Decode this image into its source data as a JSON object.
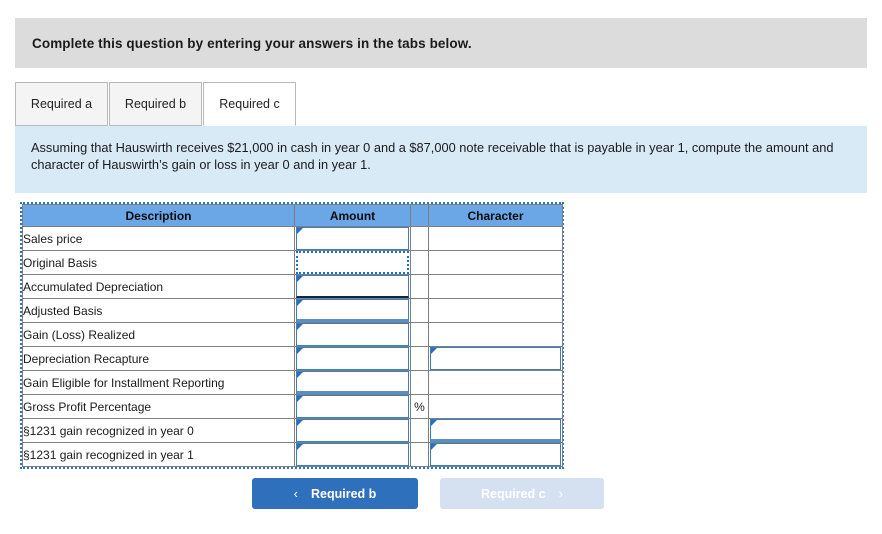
{
  "banner": {
    "text": "Complete this question by entering your answers in the tabs below."
  },
  "tabs": [
    {
      "label": "Required a",
      "active": false
    },
    {
      "label": "Required b",
      "active": false
    },
    {
      "label": "Required c",
      "active": true
    }
  ],
  "instructions": {
    "text": "Assuming that Hauswirth receives $21,000 in cash in year 0 and a $87,000 note receivable that is payable in year 1, compute the amount and character of Hauswirth’s gain or loss in year 0 and in year 1."
  },
  "table": {
    "headers": {
      "description": "Description",
      "amount": "Amount",
      "spacer": "",
      "character": "Character"
    },
    "percent_symbol": "%",
    "rows": [
      {
        "label": "Sales price",
        "amount_value": "",
        "amount_input": true,
        "amount_state": "normal",
        "percent": "",
        "character_value": "",
        "character_input": false,
        "character_state": "none"
      },
      {
        "label": "Original Basis",
        "amount_value": "",
        "amount_input": true,
        "amount_state": "selected",
        "percent": "",
        "character_value": "",
        "character_input": false,
        "character_state": "none"
      },
      {
        "label": "Accumulated Depreciation",
        "amount_value": "",
        "amount_input": true,
        "amount_state": "underline-dark",
        "percent": "",
        "character_value": "",
        "character_input": false,
        "character_state": "none"
      },
      {
        "label": "Adjusted Basis",
        "amount_value": "",
        "amount_input": true,
        "amount_state": "underline-thick",
        "percent": "",
        "character_value": "",
        "character_input": false,
        "character_state": "none"
      },
      {
        "label": "Gain (Loss) Realized",
        "amount_value": "",
        "amount_input": true,
        "amount_state": "normal",
        "percent": "",
        "character_value": "",
        "character_input": false,
        "character_state": "none"
      },
      {
        "label": "Depreciation Recapture",
        "amount_value": "",
        "amount_input": true,
        "amount_state": "normal",
        "percent": "",
        "character_value": "",
        "character_input": true,
        "character_state": "normal"
      },
      {
        "label": "Gain Eligible for Installment Reporting",
        "amount_value": "",
        "amount_input": true,
        "amount_state": "underline-thick",
        "percent": "",
        "character_value": "",
        "character_input": false,
        "character_state": "none"
      },
      {
        "label": "Gross Profit Percentage",
        "amount_value": "",
        "amount_input": true,
        "amount_state": "normal",
        "percent": "%",
        "character_value": "",
        "character_input": false,
        "character_state": "none"
      },
      {
        "label": "§1231 gain recognized in year 0",
        "amount_value": "",
        "amount_input": true,
        "amount_state": "normal",
        "percent": "",
        "character_value": "",
        "character_input": true,
        "character_state": "underline-thick"
      },
      {
        "label": "§1231 gain recognized in year 1",
        "amount_value": "",
        "amount_input": true,
        "amount_state": "normal",
        "percent": "",
        "character_value": "",
        "character_input": true,
        "character_state": "normal"
      }
    ]
  },
  "nav": {
    "prev_label": "Required b",
    "prev_chevron": "‹",
    "next_label": "Required c",
    "next_chevron": "›"
  },
  "colors": {
    "banner_gray": "#dcdcdc",
    "panel_blue": "#d9eaf7",
    "header_blue": "#6ba6e6",
    "button_blue": "#2f70bd",
    "button_disabled": "#d5e1f1",
    "input_border": "#3c7fc0",
    "selection_dotted": "#1d6fce"
  }
}
